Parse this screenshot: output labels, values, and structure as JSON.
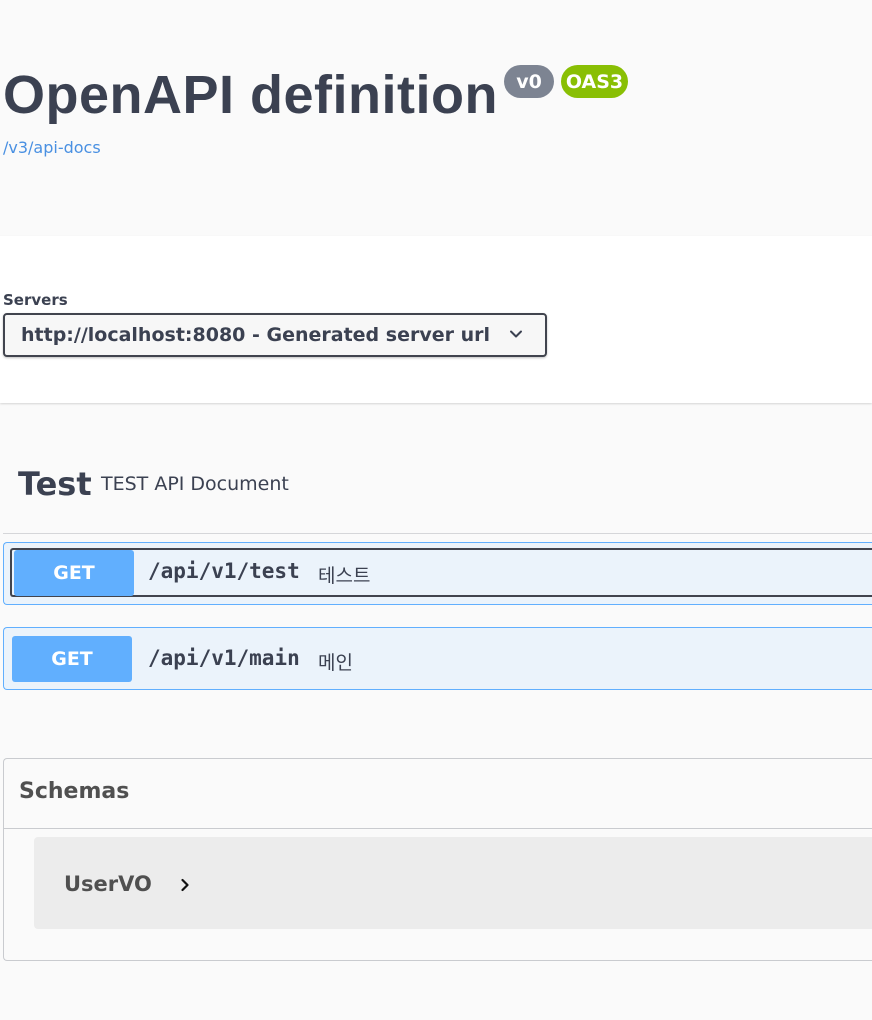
{
  "info": {
    "title": "OpenAPI definition",
    "version_badge": "v0",
    "oas_badge": "OAS3",
    "docs_link": "/v3/api-docs"
  },
  "servers": {
    "label": "Servers",
    "selected": "http://localhost:8080 - Generated server url"
  },
  "tag": {
    "name": "Test",
    "description": "TEST API Document"
  },
  "operations": [
    {
      "method": "GET",
      "path": "/api/v1/test",
      "summary": "테스트",
      "focused": true
    },
    {
      "method": "GET",
      "path": "/api/v1/main",
      "summary": "메인",
      "focused": false
    }
  ],
  "schemas": {
    "title": "Schemas",
    "models": [
      {
        "name": "UserVO"
      }
    ]
  },
  "colors": {
    "get_method": "#61affe",
    "get_background": "#ebf3fb",
    "version_badge": "#7d8492",
    "oas_badge": "#89bf04",
    "link": "#4990e2"
  }
}
